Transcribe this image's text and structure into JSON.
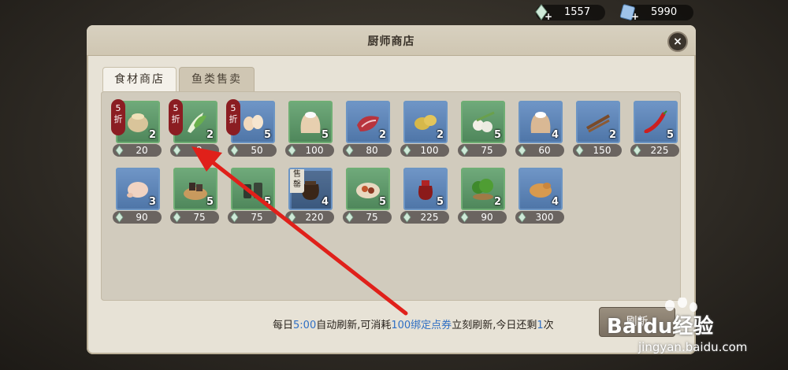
{
  "currency": {
    "gems": "1557",
    "tickets": "5990"
  },
  "window": {
    "title": "厨师商店",
    "close_label": "×"
  },
  "tabs": [
    {
      "label": "食材商店",
      "active": true
    },
    {
      "label": "鱼类售卖",
      "active": false
    }
  ],
  "discount_label": "5折",
  "soldout_label": "售罄",
  "items_row1": [
    {
      "qty": "2",
      "price": "20",
      "discount": true,
      "frame": "green",
      "food": "grain-sack"
    },
    {
      "qty": "2",
      "price": "2",
      "discount": true,
      "frame": "green",
      "food": "bok-choy"
    },
    {
      "qty": "5",
      "price": "50",
      "discount": true,
      "frame": "blue",
      "food": "eggs"
    },
    {
      "qty": "5",
      "price": "100",
      "discount": false,
      "frame": "green",
      "food": "flour-sack"
    },
    {
      "qty": "2",
      "price": "80",
      "discount": false,
      "frame": "blue",
      "food": "meat"
    },
    {
      "qty": "2",
      "price": "100",
      "discount": false,
      "frame": "blue",
      "food": "potatoes"
    },
    {
      "qty": "5",
      "price": "75",
      "discount": false,
      "frame": "green",
      "food": "garlic"
    },
    {
      "qty": "4",
      "price": "60",
      "discount": false,
      "frame": "blue",
      "food": "rice-sack"
    },
    {
      "qty": "2",
      "price": "150",
      "discount": false,
      "frame": "blue",
      "food": "cinnamon"
    },
    {
      "qty": "5",
      "price": "225",
      "discount": false,
      "frame": "blue",
      "food": "chili"
    }
  ],
  "items_row2": [
    {
      "qty": "3",
      "price": "90",
      "discount": false,
      "frame": "blue",
      "food": "chicken"
    },
    {
      "qty": "5",
      "price": "75",
      "discount": false,
      "frame": "green",
      "food": "tofu-basket"
    },
    {
      "qty": "5",
      "price": "75",
      "discount": false,
      "frame": "green",
      "food": "jars"
    },
    {
      "qty": "4",
      "price": "220",
      "discount": false,
      "frame": "blue",
      "food": "clay-pot",
      "soldout": true
    },
    {
      "qty": "5",
      "price": "75",
      "discount": false,
      "frame": "green",
      "food": "spice-plate"
    },
    {
      "qty": "5",
      "price": "225",
      "discount": false,
      "frame": "blue",
      "food": "wine-jar"
    },
    {
      "qty": "2",
      "price": "90",
      "discount": false,
      "frame": "green",
      "food": "herbs"
    },
    {
      "qty": "4",
      "price": "300",
      "discount": false,
      "frame": "blue",
      "food": "roast-duck"
    }
  ],
  "notice": {
    "p1": "每日",
    "time": "5:00",
    "p2": "自动刷新,可消耗",
    "cost": "100绑定点券",
    "p3": "立刻刷新,今日还剩",
    "remaining": "1",
    "p4": "次"
  },
  "refresh_button": "刷新",
  "watermark": {
    "brand": "Baidu经验",
    "url": "jingyan.baidu.com"
  },
  "colors": {
    "arrow": "#e0201a",
    "highlight_text": "#2f6fc4",
    "discount_badge": "#8b1d22"
  }
}
